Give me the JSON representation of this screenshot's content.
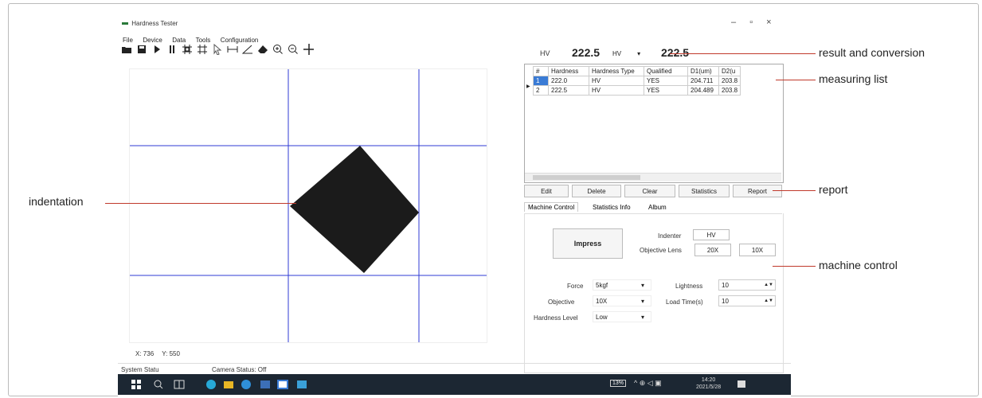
{
  "window": {
    "title": "Hardness Tester",
    "menu": [
      "File",
      "Device",
      "Data",
      "Tools",
      "Configuration"
    ],
    "controls": [
      "–",
      "▫",
      "×"
    ]
  },
  "toolbar_icons": [
    "open-folder-icon",
    "save-icon",
    "play-icon",
    "pause-icon",
    "crosshair-icon",
    "grid-icon",
    "cursor-icon",
    "measure-line-icon",
    "angle-icon",
    "eraser-icon",
    "zoom-in-icon",
    "zoom-out-icon",
    "plus-icon"
  ],
  "result": {
    "label1": "HV",
    "value1": "222.5",
    "unit": "HV",
    "value2": "222.5"
  },
  "measure_list": {
    "headers": [
      "#",
      "Hardness",
      "Hardness Type",
      "Qualified",
      "D1(um)",
      "D2(u"
    ],
    "rows": [
      [
        "1",
        "222.0",
        "HV",
        "YES",
        "204.711",
        "203.8"
      ],
      [
        "2",
        "222.5",
        "HV",
        "YES",
        "204.489",
        "203.8"
      ]
    ]
  },
  "actions": [
    "Edit",
    "Delete",
    "Clear",
    "Statistics",
    "Report"
  ],
  "tabs": [
    "Machine Control",
    "Statistics Info",
    "Album"
  ],
  "machine": {
    "impress": "Impress",
    "indenter_label": "Indenter",
    "indenter_value": "HV",
    "objective_lens_label": "Objective Lens",
    "lens_20x": "20X",
    "lens_10x": "10X",
    "force_label": "Force",
    "force_value": "5kgf",
    "objective_label": "Objective",
    "objective_value": "10X",
    "hardness_level_label": "Hardness Level",
    "hardness_level_value": "Low",
    "lightness_label": "Lightness",
    "lightness_value": "10",
    "load_time_label": "Load Time(s)",
    "load_time_value": "10"
  },
  "coords": {
    "x_label": "X:",
    "x": "736",
    "y_label": "Y:",
    "y": "550"
  },
  "status": {
    "system": "System Statu",
    "camera": "Camera Status: Off"
  },
  "taskbar": {
    "battery": "13%",
    "time": "14:20",
    "date": "2021/5/28"
  },
  "callouts": {
    "result": "result and conversion",
    "list": "measuring list",
    "report": "report",
    "machine": "machine control",
    "indentation": "indentation"
  },
  "colors": {
    "callout_line": "#c0392b",
    "grid_line": "#2f3bd6",
    "taskbar": "#1c2733",
    "selected": "#3a7bd5"
  }
}
